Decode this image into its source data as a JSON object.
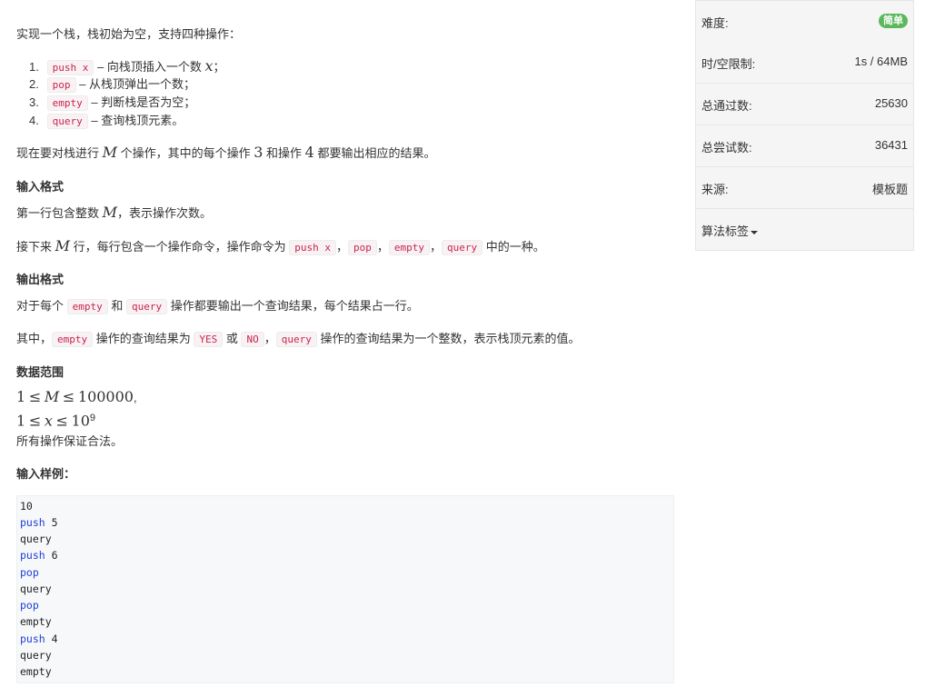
{
  "intro": "实现一个栈，栈初始为空，支持四种操作：",
  "ops": [
    {
      "num": "1.",
      "code": "push x",
      "desc": "– 向栈顶插入一个数 ",
      "math": "x",
      "tail": "；"
    },
    {
      "num": "2.",
      "code": "pop",
      "desc": "– 从栈顶弹出一个数；",
      "math": "",
      "tail": ""
    },
    {
      "num": "3.",
      "code": "empty",
      "desc": "– 判断栈是否为空；",
      "math": "",
      "tail": ""
    },
    {
      "num": "4.",
      "code": "query",
      "desc": "– 查询栈顶元素。",
      "math": "",
      "tail": ""
    }
  ],
  "para_ops": {
    "a": "现在要对栈进行 ",
    "M": "M",
    "b": " 个操作，其中的每个操作 ",
    "n3": "3",
    "c": " 和操作 ",
    "n4": "4",
    "d": " 都要输出相应的结果。"
  },
  "input_format": {
    "heading": "输入格式",
    "line1_a": "第一行包含整数 ",
    "line1_M": "M",
    "line1_b": "，表示操作次数。",
    "line2_a": "接下来 ",
    "line2_M": "M",
    "line2_b": " 行，每行包含一个操作命令，操作命令为 ",
    "cmds": [
      "push x",
      "pop",
      "empty",
      "query"
    ],
    "sep": "，",
    "line2_c": " 中的一种。"
  },
  "output_format": {
    "heading": "输出格式",
    "l1_a": "对于每个 ",
    "l1_c1": "empty",
    "l1_b": " 和 ",
    "l1_c2": "query",
    "l1_c": " 操作都要输出一个查询结果，每个结果占一行。",
    "l2_a": "其中，",
    "l2_c1": "empty",
    "l2_b": " 操作的查询结果为 ",
    "l2_c2": "YES",
    "l2_or": " 或 ",
    "l2_c3": "NO",
    "l2_sep": "，",
    "l2_c4": "query",
    "l2_c": " 操作的查询结果为一个整数，表示栈顶元素的值。"
  },
  "range": {
    "heading": "数据范围",
    "r1_a": "1",
    "r1_le1": "≤",
    "r1_M": "M",
    "r1_le2": "≤",
    "r1_b": "100000",
    "r1_tail": ",",
    "r2_a": "1",
    "r2_le1": "≤",
    "r2_x": "x",
    "r2_le2": "≤",
    "r2_b": "10",
    "r2_exp": "9",
    "note": "所有操作保证合法。"
  },
  "sample": {
    "heading": "输入样例：",
    "lines": [
      {
        "kw": "",
        "rest": "10"
      },
      {
        "kw": "push",
        "rest": " 5"
      },
      {
        "kw": "",
        "rest": "query"
      },
      {
        "kw": "push",
        "rest": " 6"
      },
      {
        "kw": "pop",
        "rest": ""
      },
      {
        "kw": "",
        "rest": "query"
      },
      {
        "kw": "pop",
        "rest": ""
      },
      {
        "kw": "",
        "rest": "empty"
      },
      {
        "kw": "push",
        "rest": " 4"
      },
      {
        "kw": "",
        "rest": "query"
      },
      {
        "kw": "",
        "rest": "empty"
      }
    ]
  },
  "sidebar": {
    "difficulty_label": "难度:",
    "difficulty_value": "简单",
    "limit_label": "时/空限制:",
    "limit_value": "1s / 64MB",
    "passed_label": "总通过数:",
    "passed_value": "25630",
    "tried_label": "总尝试数:",
    "tried_value": "36431",
    "source_label": "来源:",
    "source_value": "模板题",
    "tags_label": "算法标签"
  },
  "colors": {
    "badge": "#5cb85c",
    "keyword": "#1f3fd6",
    "code_text": "#c7254e"
  }
}
